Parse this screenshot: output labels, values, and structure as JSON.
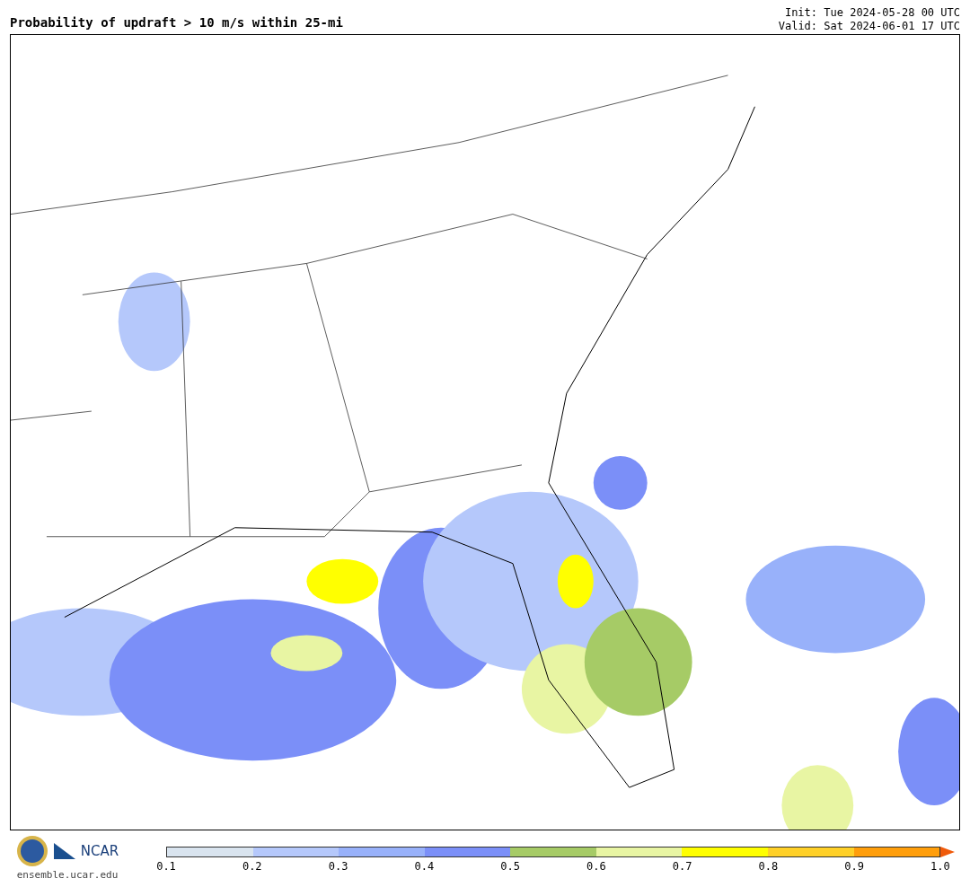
{
  "title": "Probability of updraft > 10 m/s within 25-mi",
  "init": "Init: Tue 2024-05-28 00 UTC",
  "valid": "Valid: Sat 2024-06-01 17 UTC",
  "logos": {
    "ncar": "NCAR",
    "site": "ensemble.ucar.edu"
  },
  "colorbar": {
    "segments": [
      {
        "kind": "band",
        "color": "#d9e4ef"
      },
      {
        "kind": "band",
        "color": "#b5c8fb"
      },
      {
        "kind": "band",
        "color": "#98b1fa"
      },
      {
        "kind": "band",
        "color": "#7b8ff8"
      },
      {
        "kind": "band",
        "color": "#a6cb66"
      },
      {
        "kind": "band",
        "color": "#e8f5a3"
      },
      {
        "kind": "band",
        "color": "#ffff00"
      },
      {
        "kind": "band",
        "color": "#ffd027"
      },
      {
        "kind": "band",
        "color": "#ff9e0b"
      },
      {
        "kind": "arrow",
        "color": "#f05a0a"
      }
    ],
    "ticks": [
      "0.1",
      "0.2",
      "0.3",
      "0.4",
      "0.5",
      "0.6",
      "0.7",
      "0.8",
      "0.9",
      "1.0"
    ]
  }
}
